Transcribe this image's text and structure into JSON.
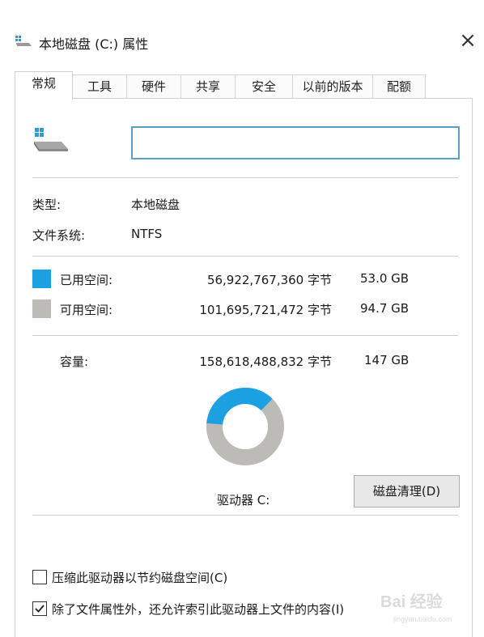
{
  "window": {
    "title": "本地磁盘 (C:) 属性",
    "close_glyph": "×"
  },
  "tabs": [
    {
      "label": "常规",
      "active": true
    },
    {
      "label": "工具",
      "active": false
    },
    {
      "label": "硬件",
      "active": false
    },
    {
      "label": "共享",
      "active": false
    },
    {
      "label": "安全",
      "active": false
    },
    {
      "label": "以前的版本",
      "active": false
    },
    {
      "label": "配额",
      "active": false
    }
  ],
  "general": {
    "name_value": "",
    "type_label": "类型:",
    "type_value": "本地磁盘",
    "fs_label": "文件系统:",
    "fs_value": "NTFS",
    "used": {
      "label": "已用空间:",
      "bytes": "56,922,767,360 字节",
      "size": "53.0 GB",
      "color": "#1ba1e2"
    },
    "free": {
      "label": "可用空间:",
      "bytes": "101,695,721,472 字节",
      "size": "94.7 GB",
      "color": "#bdbbb8"
    },
    "capacity": {
      "label": "容量:",
      "bytes": "158,618,488,832 字节",
      "size": "147 GB"
    },
    "usage_fraction": 0.359,
    "drive_label": "驱动器 C:",
    "cleanup_button": "磁盘清理(D)",
    "compress_checkbox": {
      "label": "压缩此驱动器以节约磁盘空间(C)",
      "checked": false
    },
    "index_checkbox": {
      "label": "除了文件属性外，还允许索引此驱动器上文件的内容(I)",
      "checked": true
    }
  },
  "icons": {
    "title": "drive-icon",
    "drive": "windows-drive-icon",
    "close": "close-icon",
    "check": "check-icon"
  },
  "watermark": {
    "text": "Bai 经验",
    "sub": "jingyan.baidu.com"
  }
}
